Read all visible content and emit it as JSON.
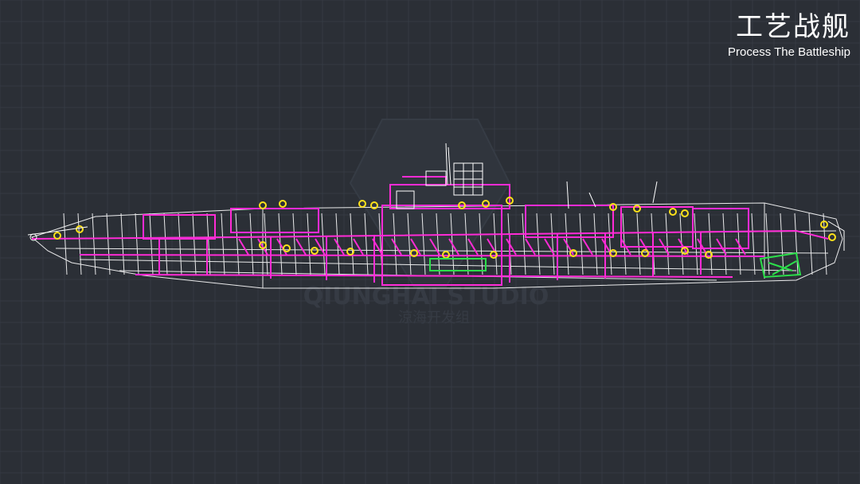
{
  "header": {
    "title_cn": "工艺战舰",
    "title_en": "Process The Battleship"
  },
  "watermark": {
    "studio_en": "QIUNGHAI STUDIO",
    "studio_cn": "涼海开发组"
  },
  "colors": {
    "background": "#2b2f36",
    "grid_line": "#343942",
    "wireframe_white": "#ffffff",
    "wireframe_magenta": "#ff2bd6",
    "wireframe_yellow": "#ffe21a",
    "wireframe_green": "#2be04a"
  },
  "scene": {
    "subject": "aircraft carrier wireframe side view"
  }
}
